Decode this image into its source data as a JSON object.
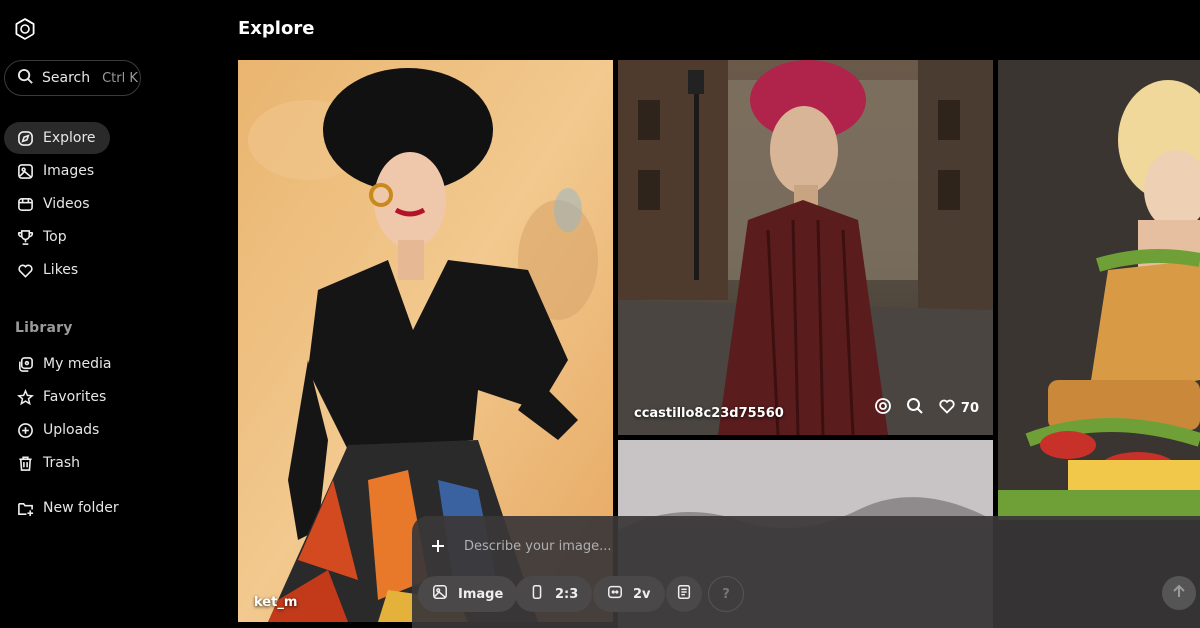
{
  "sidebar": {
    "search": {
      "label": "Search",
      "shortcut": "Ctrl K"
    },
    "nav": [
      {
        "label": "Explore",
        "icon": "explore-icon",
        "active": true
      },
      {
        "label": "Images",
        "icon": "image-icon"
      },
      {
        "label": "Videos",
        "icon": "video-icon"
      },
      {
        "label": "Top",
        "icon": "trophy-icon"
      },
      {
        "label": "Likes",
        "icon": "heart-icon"
      }
    ],
    "library": {
      "heading": "Library",
      "items": [
        {
          "label": "My media",
          "icon": "media-icon"
        },
        {
          "label": "Favorites",
          "icon": "star-icon"
        },
        {
          "label": "Uploads",
          "icon": "upload-icon"
        },
        {
          "label": "Trash",
          "icon": "trash-icon"
        }
      ]
    },
    "new_folder": {
      "label": "New folder",
      "icon": "new-folder-icon"
    }
  },
  "main": {
    "title": "Explore",
    "tiles": [
      {
        "user": "ket_m"
      },
      {
        "user": "ccastillo8c23d75560",
        "likes": "70"
      },
      {
        "user": ""
      },
      {
        "user": ""
      }
    ]
  },
  "composer": {
    "placeholder": "Describe your image...",
    "chips": [
      {
        "label": "Image",
        "icon": "image-icon"
      },
      {
        "label": "2:3",
        "icon": "aspect-ratio-icon"
      },
      {
        "label": "2v",
        "icon": "variations-icon"
      },
      {
        "label": "",
        "icon": "preset-icon"
      },
      {
        "label": "?",
        "icon": "help-icon"
      }
    ]
  },
  "colors": {
    "background": "#000000",
    "composer": "#3a3738",
    "chip": "#4b4849"
  }
}
